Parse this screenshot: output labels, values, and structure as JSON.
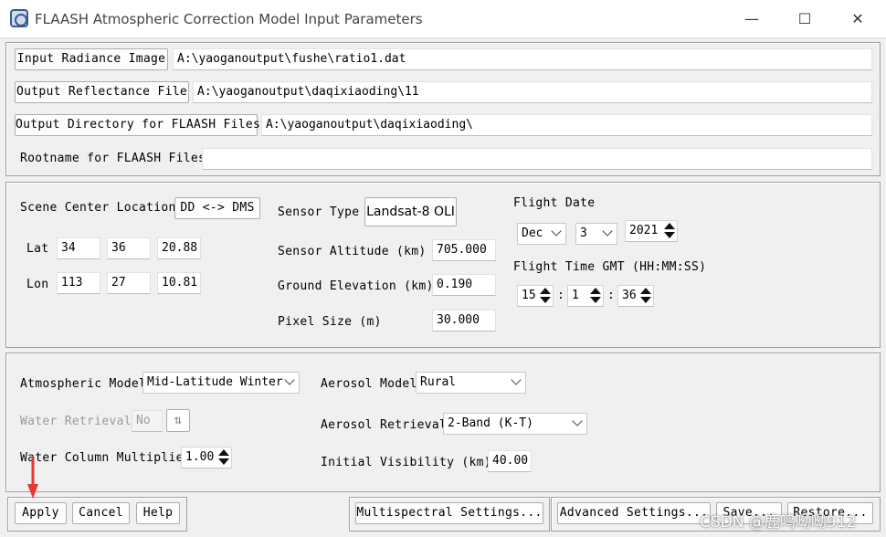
{
  "window": {
    "title": "FLAASH Atmospheric Correction Model Input Parameters",
    "minimize_glyph": "—",
    "maximize_glyph": "☐",
    "close_glyph": "✕"
  },
  "files": {
    "input_radiance_button": "Input Radiance Image",
    "input_radiance_value": "A:\\yaoganoutput\\fushe\\ratio1.dat",
    "output_reflectance_button": "Output Reflectance File",
    "output_reflectance_value": "A:\\yaoganoutput\\daqixiaoding\\11",
    "output_directory_button": "Output Directory for FLAASH Files",
    "output_directory_value": "A:\\yaoganoutput\\daqixiaoding\\",
    "rootname_label": "Rootname for FLAASH Files",
    "rootname_value": ""
  },
  "scene": {
    "center_location_label": "Scene Center Location",
    "dd_dms_button": "DD <-> DMS",
    "lat_label": "Lat",
    "lat": [
      "34",
      "36",
      "20.88"
    ],
    "lon_label": "Lon",
    "lon": [
      "113",
      "27",
      "10.81"
    ],
    "sensor_type_label": "Sensor Type",
    "sensor_type_value": "Landsat-8 OLI",
    "sensor_altitude_label": "Sensor Altitude (km)",
    "sensor_altitude_value": "705.000",
    "ground_elevation_label": "Ground Elevation (km)",
    "ground_elevation_value": "0.190",
    "pixel_size_label": "Pixel Size (m)",
    "pixel_size_value": "30.000",
    "flight_date_label": "Flight Date",
    "flight_month": "Dec",
    "flight_day": "3",
    "flight_year": "2021",
    "flight_time_label": "Flight Time GMT (HH:MM:SS)",
    "flight_hour": "15",
    "flight_minute": "1",
    "flight_second": "36",
    "time_separator": ":"
  },
  "atmosphere": {
    "atmospheric_model_label": "Atmospheric Model",
    "atmospheric_model_value": "Mid-Latitude Winter",
    "water_retrieval_label": "Water Retrieval",
    "water_retrieval_value": "No",
    "water_column_label": "Water Column Multiplier",
    "water_column_value": "1.00",
    "aerosol_model_label": "Aerosol Model",
    "aerosol_model_value": "Rural",
    "aerosol_retrieval_label": "Aerosol Retrieval",
    "aerosol_retrieval_value": "2-Band (K-T)",
    "initial_visibility_label": "Initial Visibility (km)",
    "initial_visibility_value": "40.00"
  },
  "footer": {
    "apply": "Apply",
    "cancel": "Cancel",
    "help": "Help",
    "multispectral": "Multispectral Settings...",
    "advanced": "Advanced Settings...",
    "save": "Save...",
    "restore": "Restore..."
  },
  "watermark": "CSDN @鹿鸣呦呦912",
  "colors": {
    "window_bg": "#f0f0f0",
    "titlebar_bg": "#ffffff",
    "annotation_arrow": "#e53935"
  }
}
